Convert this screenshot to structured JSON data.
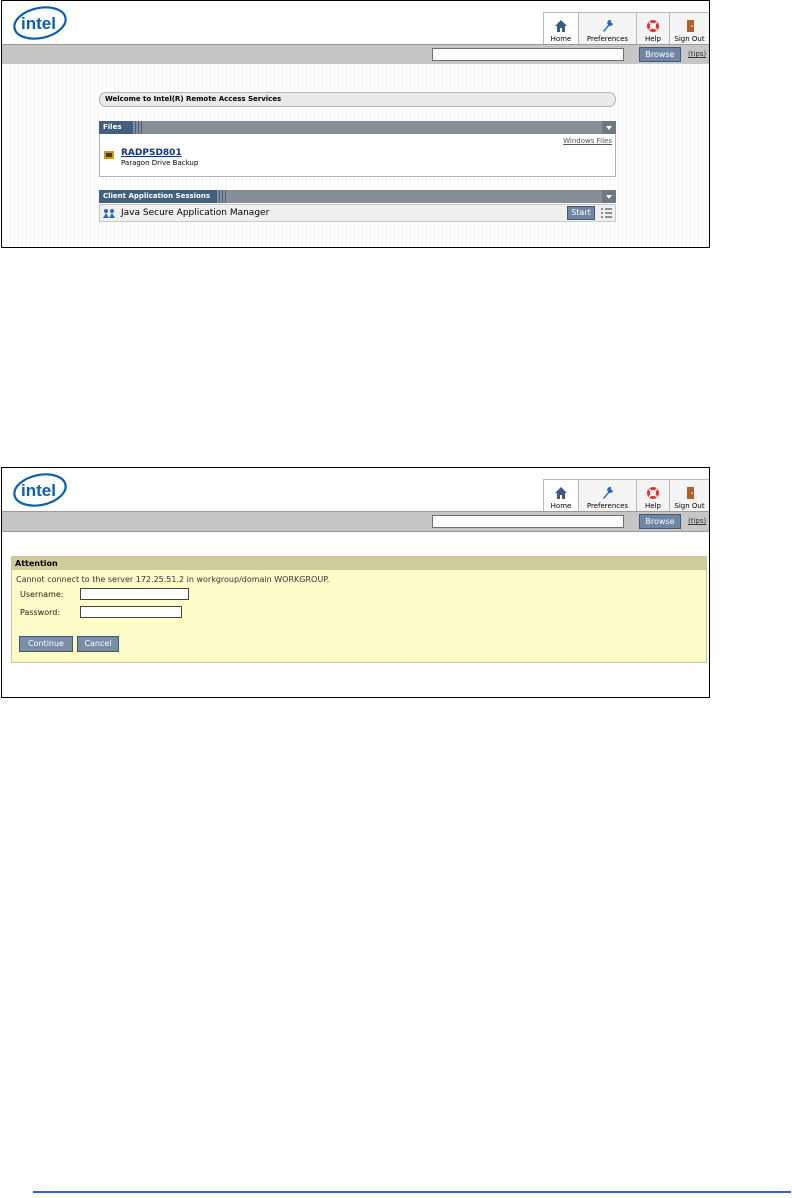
{
  "colors": {
    "accent_blue": "#41607f",
    "button": "#6f87a5",
    "attention_bg": "#fcfcc9",
    "rule": "#3a65c8"
  },
  "header": {
    "logo_text": "intel",
    "nav": {
      "home": "Home",
      "preferences": "Preferences",
      "help": "Help",
      "sign_out": "Sign Out"
    },
    "browse_button": "Browse",
    "tips_link": "(tips)",
    "icons": {
      "home": "home-icon",
      "preferences": "wrench-icon",
      "help": "lifebuoy-icon",
      "sign_out": "door-icon"
    }
  },
  "shot1": {
    "welcome": "Welcome to Intel(R) Remote Access Services",
    "files": {
      "title": "Files",
      "windows_files_link": "Windows Files",
      "item_name": "RADPSD801",
      "item_desc": "Paragon Drive Backup"
    },
    "sessions": {
      "title": "Client Application Sessions",
      "app_name": "Java Secure Application Manager",
      "start_button": "Start"
    }
  },
  "shot2": {
    "attention": {
      "title": "Attention",
      "message": "Cannot connect to the server 172.25.51.2 in workgroup/domain WORKGROUP.",
      "username_label": "Username:",
      "password_label": "Password:",
      "continue_button": "Continue",
      "cancel_button": "Cancel"
    }
  }
}
